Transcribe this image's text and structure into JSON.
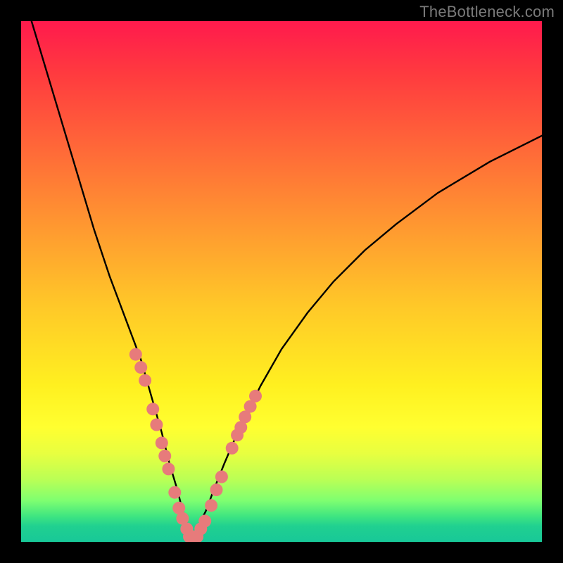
{
  "watermark": "TheBottleneck.com",
  "chart_data": {
    "type": "line",
    "title": "",
    "xlabel": "",
    "ylabel": "",
    "xlim": [
      0,
      100
    ],
    "ylim": [
      0,
      100
    ],
    "curve": {
      "name": "bottleneck-curve",
      "x": [
        2,
        5,
        8,
        11,
        14,
        17,
        20,
        23,
        25,
        27,
        28.5,
        30,
        31,
        32,
        33,
        34,
        35.5,
        37,
        39,
        42,
        46,
        50,
        55,
        60,
        66,
        72,
        80,
        90,
        100
      ],
      "y": [
        100,
        90,
        80,
        70,
        60,
        51,
        43,
        35,
        28,
        21,
        15,
        10,
        6,
        3,
        1,
        3,
        6,
        10,
        15,
        22,
        30,
        37,
        44,
        50,
        56,
        61,
        67,
        73,
        78
      ]
    },
    "points_left": {
      "name": "left-branch-markers",
      "color": "#e77b7b",
      "x": [
        22.0,
        23.0,
        23.8,
        25.3,
        26.0,
        27.0,
        27.6,
        28.3,
        29.5,
        30.3,
        31.0,
        31.8
      ],
      "y": [
        36.0,
        33.5,
        31.0,
        25.5,
        22.5,
        19.0,
        16.5,
        14.0,
        9.5,
        6.5,
        4.5,
        2.5
      ]
    },
    "points_right": {
      "name": "right-branch-markers",
      "color": "#e77b7b",
      "x": [
        34.5,
        35.3,
        36.5,
        37.5,
        38.5,
        40.5,
        41.5,
        42.2,
        43.0,
        44.0,
        45.0
      ],
      "y": [
        2.5,
        4.0,
        7.0,
        10.0,
        12.5,
        18.0,
        20.5,
        22.0,
        24.0,
        26.0,
        28.0
      ]
    },
    "points_bottom": {
      "name": "minimum-markers",
      "color": "#e77b7b",
      "x": [
        32.3,
        33.0,
        33.8
      ],
      "y": [
        1.0,
        1.0,
        1.0
      ]
    },
    "background": "rainbow-gradient-vertical"
  }
}
